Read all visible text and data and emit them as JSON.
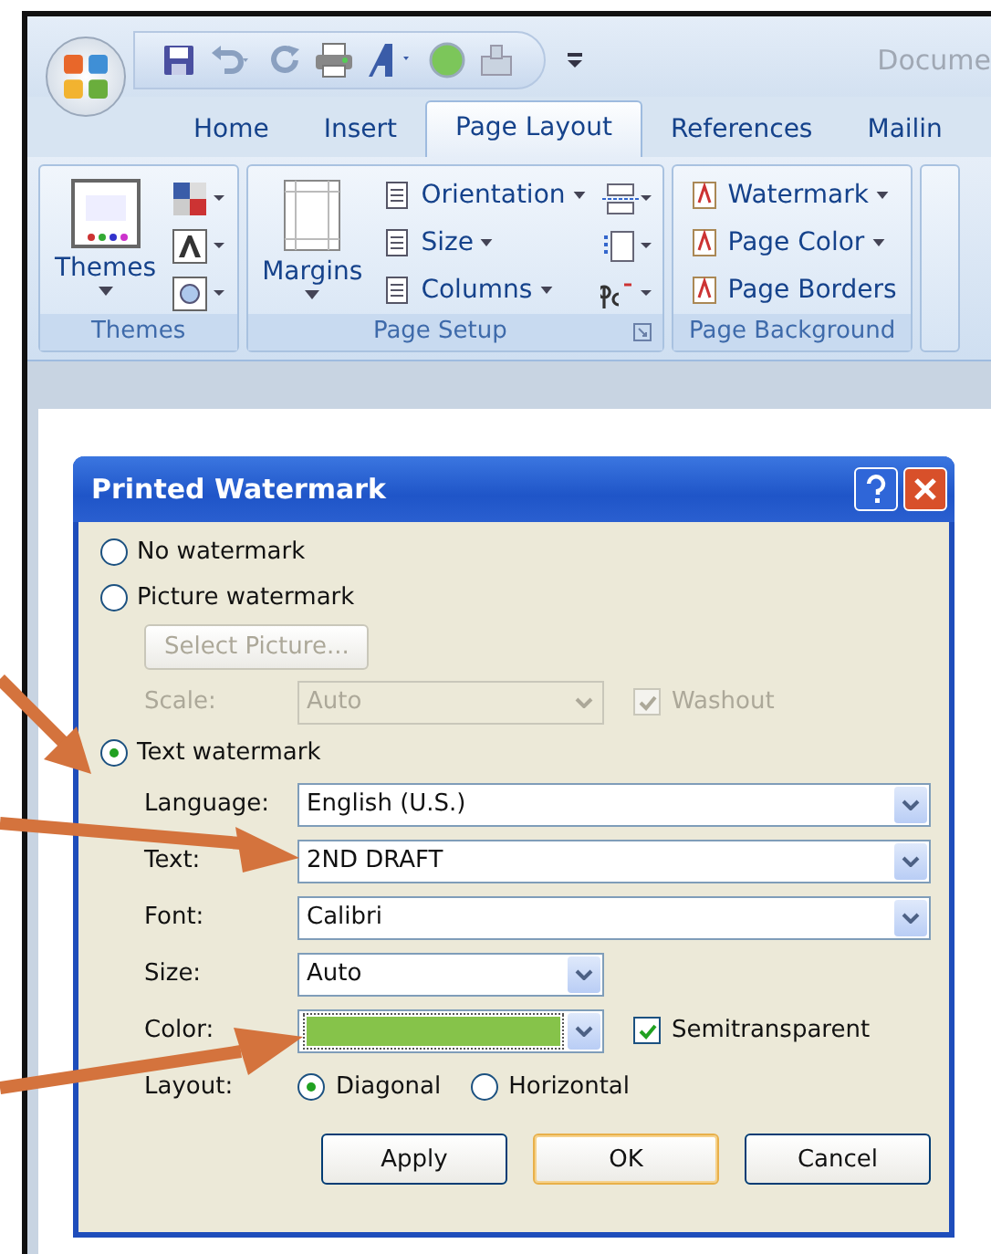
{
  "window": {
    "title": "Docume"
  },
  "quick_access": [
    {
      "kind": "save"
    },
    {
      "kind": "undo"
    },
    {
      "kind": "redo"
    },
    {
      "kind": "print"
    },
    {
      "kind": "font"
    },
    {
      "kind": "circle"
    },
    {
      "kind": "stamp"
    }
  ],
  "tabs": [
    {
      "label": "Home",
      "selected": false
    },
    {
      "label": "Insert",
      "selected": false
    },
    {
      "label": "Page Layout",
      "selected": true
    },
    {
      "label": "References",
      "selected": false
    },
    {
      "label": "Mailin",
      "selected": false
    }
  ],
  "ribbon": {
    "themes": {
      "button": "Themes",
      "group": "Themes"
    },
    "page_setup": {
      "margins": "Margins",
      "items": [
        "Orientation",
        "Size",
        "Columns"
      ],
      "group": "Page Setup"
    },
    "page_background": {
      "items": [
        {
          "label": "Watermark",
          "dropdown": true
        },
        {
          "label": "Page Color",
          "dropdown": true
        },
        {
          "label": "Page Borders",
          "dropdown": false
        }
      ],
      "group": "Page Background"
    }
  },
  "dialog": {
    "title": "Printed Watermark",
    "options": [
      {
        "label": "No watermark",
        "selected": false
      },
      {
        "label": "Picture watermark",
        "selected": false
      }
    ],
    "select_picture": {
      "label": "Select Picture...",
      "disabled": true
    },
    "scale": {
      "label": "Scale:",
      "value": "Auto",
      "disabled": true
    },
    "washout": {
      "label": "Washout",
      "checked": true,
      "disabled": true
    },
    "text_option": {
      "label": "Text watermark",
      "selected": true
    },
    "fields": [
      {
        "label": "Language:",
        "value": "English (U.S.)",
        "kind": "wide"
      },
      {
        "label": "Text:",
        "value": "2ND DRAFT",
        "kind": "wide"
      },
      {
        "label": "Font:",
        "value": "Calibri",
        "kind": "wide"
      },
      {
        "label": "Size:",
        "value": "Auto",
        "kind": "narrow"
      }
    ],
    "color": {
      "label": "Color:",
      "color": "#86c34a"
    },
    "semitransparent": {
      "label": "Semitransparent",
      "checked": true
    },
    "layout": {
      "label": "Layout:",
      "options": [
        {
          "label": "Diagonal",
          "selected": true
        },
        {
          "label": "Horizontal",
          "selected": false
        }
      ]
    },
    "buttons": [
      {
        "label": "Apply",
        "default": false
      },
      {
        "label": "OK",
        "default": true
      },
      {
        "label": "Cancel",
        "default": false
      }
    ]
  }
}
